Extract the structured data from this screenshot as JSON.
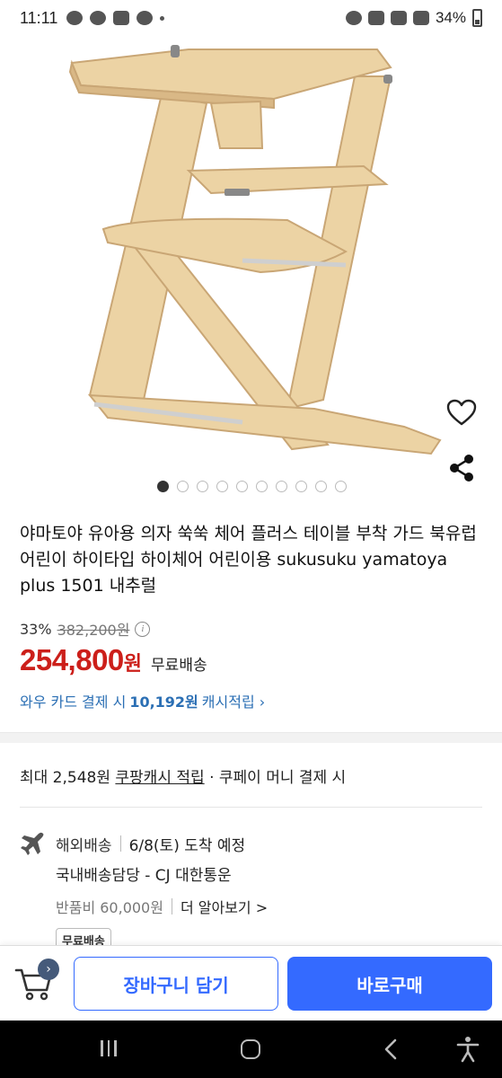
{
  "status_bar": {
    "time": "11:11",
    "battery": "34%"
  },
  "product": {
    "title": "야마토야 유아용 의자 쑥쑥 체어 플러스 테이블 부착 가드 북유럽 어린이 하이타입 하이체어 어린이용 sukusuku yamatoya plus 1501 내추럴",
    "carousel_total": 10,
    "carousel_current": 1
  },
  "price": {
    "discount": "33%",
    "original": "382,200원",
    "sale_amount": "254,800",
    "sale_unit": "원",
    "shipping": "무료배송"
  },
  "wow_card": {
    "prefix": "와우 카드 결제 시",
    "amount": "10,192원",
    "suffix": "캐시적립 ›"
  },
  "cash": {
    "prefix": "최대 2,548원",
    "link": "쿠팡캐시 적립",
    "suffix": "· 쿠페이 머니 결제 시"
  },
  "delivery": {
    "type": "해외배송",
    "arrival": "6/8(토) 도착 예정",
    "domestic_carrier": "국내배송담당 - CJ 대한통운",
    "return_fee": "반품비 60,000원",
    "more": "더 알아보기 >",
    "badge": "무료배송"
  },
  "actions": {
    "cart_badge": "›",
    "add_to_cart": "장바구니 담기",
    "buy_now": "바로구매"
  },
  "colors": {
    "price_red": "#cc1f1a",
    "link_blue": "#2b6fb4",
    "button_blue": "#346aff"
  }
}
